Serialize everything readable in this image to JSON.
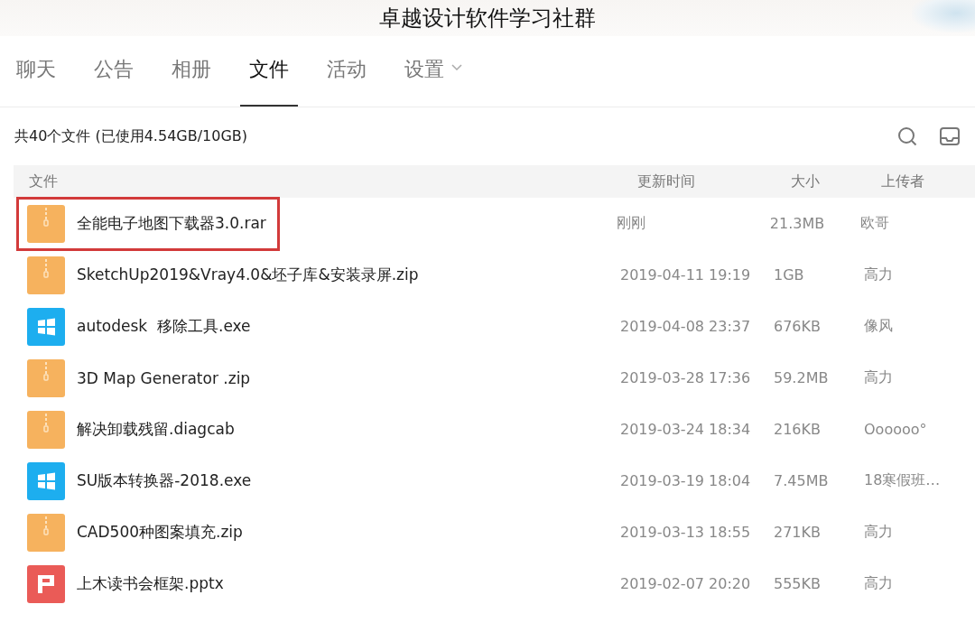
{
  "window": {
    "title": "卓越设计软件学习社群"
  },
  "tabs": [
    {
      "label": "聊天",
      "selected": false,
      "has_menu": false
    },
    {
      "label": "公告",
      "selected": false,
      "has_menu": false
    },
    {
      "label": "相册",
      "selected": false,
      "has_menu": false
    },
    {
      "label": "文件",
      "selected": true,
      "has_menu": false
    },
    {
      "label": "活动",
      "selected": false,
      "has_menu": false
    },
    {
      "label": "设置",
      "selected": false,
      "has_menu": true
    }
  ],
  "summary": "共40个文件 (已使用4.54GB/10GB)",
  "table": {
    "columns": [
      "文件",
      "更新时间",
      "大小",
      "上传者"
    ],
    "rows": [
      {
        "kind": "archive",
        "name": "全能电子地图下载器3.0.rar",
        "time": "刚刚",
        "size": "21.3MB",
        "uploader": "欧哥",
        "highlighted": true
      },
      {
        "kind": "archive",
        "name": "SketchUp2019&Vray4.0&坯子库&安装录屏.zip",
        "time": "2019-04-11 19:19",
        "size": "1GB",
        "uploader": "高力",
        "highlighted": false
      },
      {
        "kind": "exe",
        "name": "autodesk  移除工具.exe",
        "time": "2019-04-08 23:37",
        "size": "676KB",
        "uploader": "像风",
        "highlighted": false
      },
      {
        "kind": "archive",
        "name": "3D Map Generator .zip",
        "time": "2019-03-28 17:36",
        "size": "59.2MB",
        "uploader": "高力",
        "highlighted": false
      },
      {
        "kind": "archive",
        "name": "解决卸载残留.diagcab",
        "time": "2019-03-24 18:34",
        "size": "216KB",
        "uploader": "Oooooo°",
        "highlighted": false
      },
      {
        "kind": "exe",
        "name": "SU版本转换器-2018.exe",
        "time": "2019-03-19 18:04",
        "size": "7.45MB",
        "uploader": "18寒假班…",
        "highlighted": false
      },
      {
        "kind": "archive",
        "name": "CAD500种图案填充.zip",
        "time": "2019-03-13 18:55",
        "size": "271KB",
        "uploader": "高力",
        "highlighted": false
      },
      {
        "kind": "slides",
        "name": "上木读书会框架.pptx",
        "time": "2019-02-07 20:20",
        "size": "555KB",
        "uploader": "高力",
        "highlighted": false
      }
    ]
  }
}
